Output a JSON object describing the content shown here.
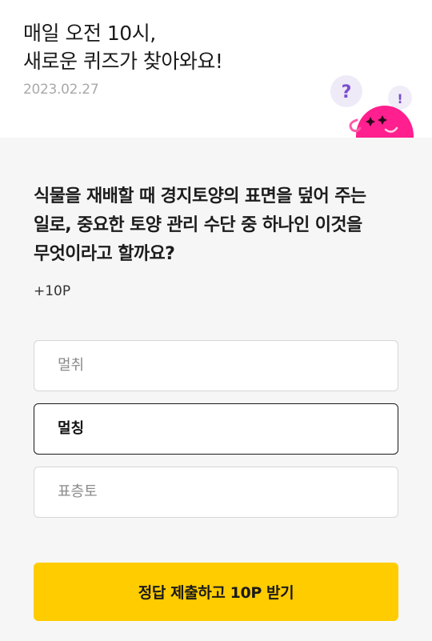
{
  "header": {
    "title_line1": "매일 오전 10시,",
    "title_line2": "새로운 퀴즈가 찾아와요!",
    "date": "2023.02.27",
    "mascot_bubble_question": "?",
    "mascot_bubble_exclaim": "!"
  },
  "quiz": {
    "question": "식물을 재배할 때 경지토양의 표면을 덮어 주는 일로, 중요한 토양 관리 수단 중 하나인 이것을 무엇이라고 할까요?",
    "points": "+10P",
    "options": [
      {
        "label": "멀취",
        "selected": false
      },
      {
        "label": "멀칭",
        "selected": true
      },
      {
        "label": "표층토",
        "selected": false
      }
    ]
  },
  "submit": {
    "label": "정답 제출하고 10P 받기"
  },
  "colors": {
    "accent": "#ffcc00",
    "mascot": "#ff1f8e",
    "bubble_icon": "#7b4fd0"
  }
}
